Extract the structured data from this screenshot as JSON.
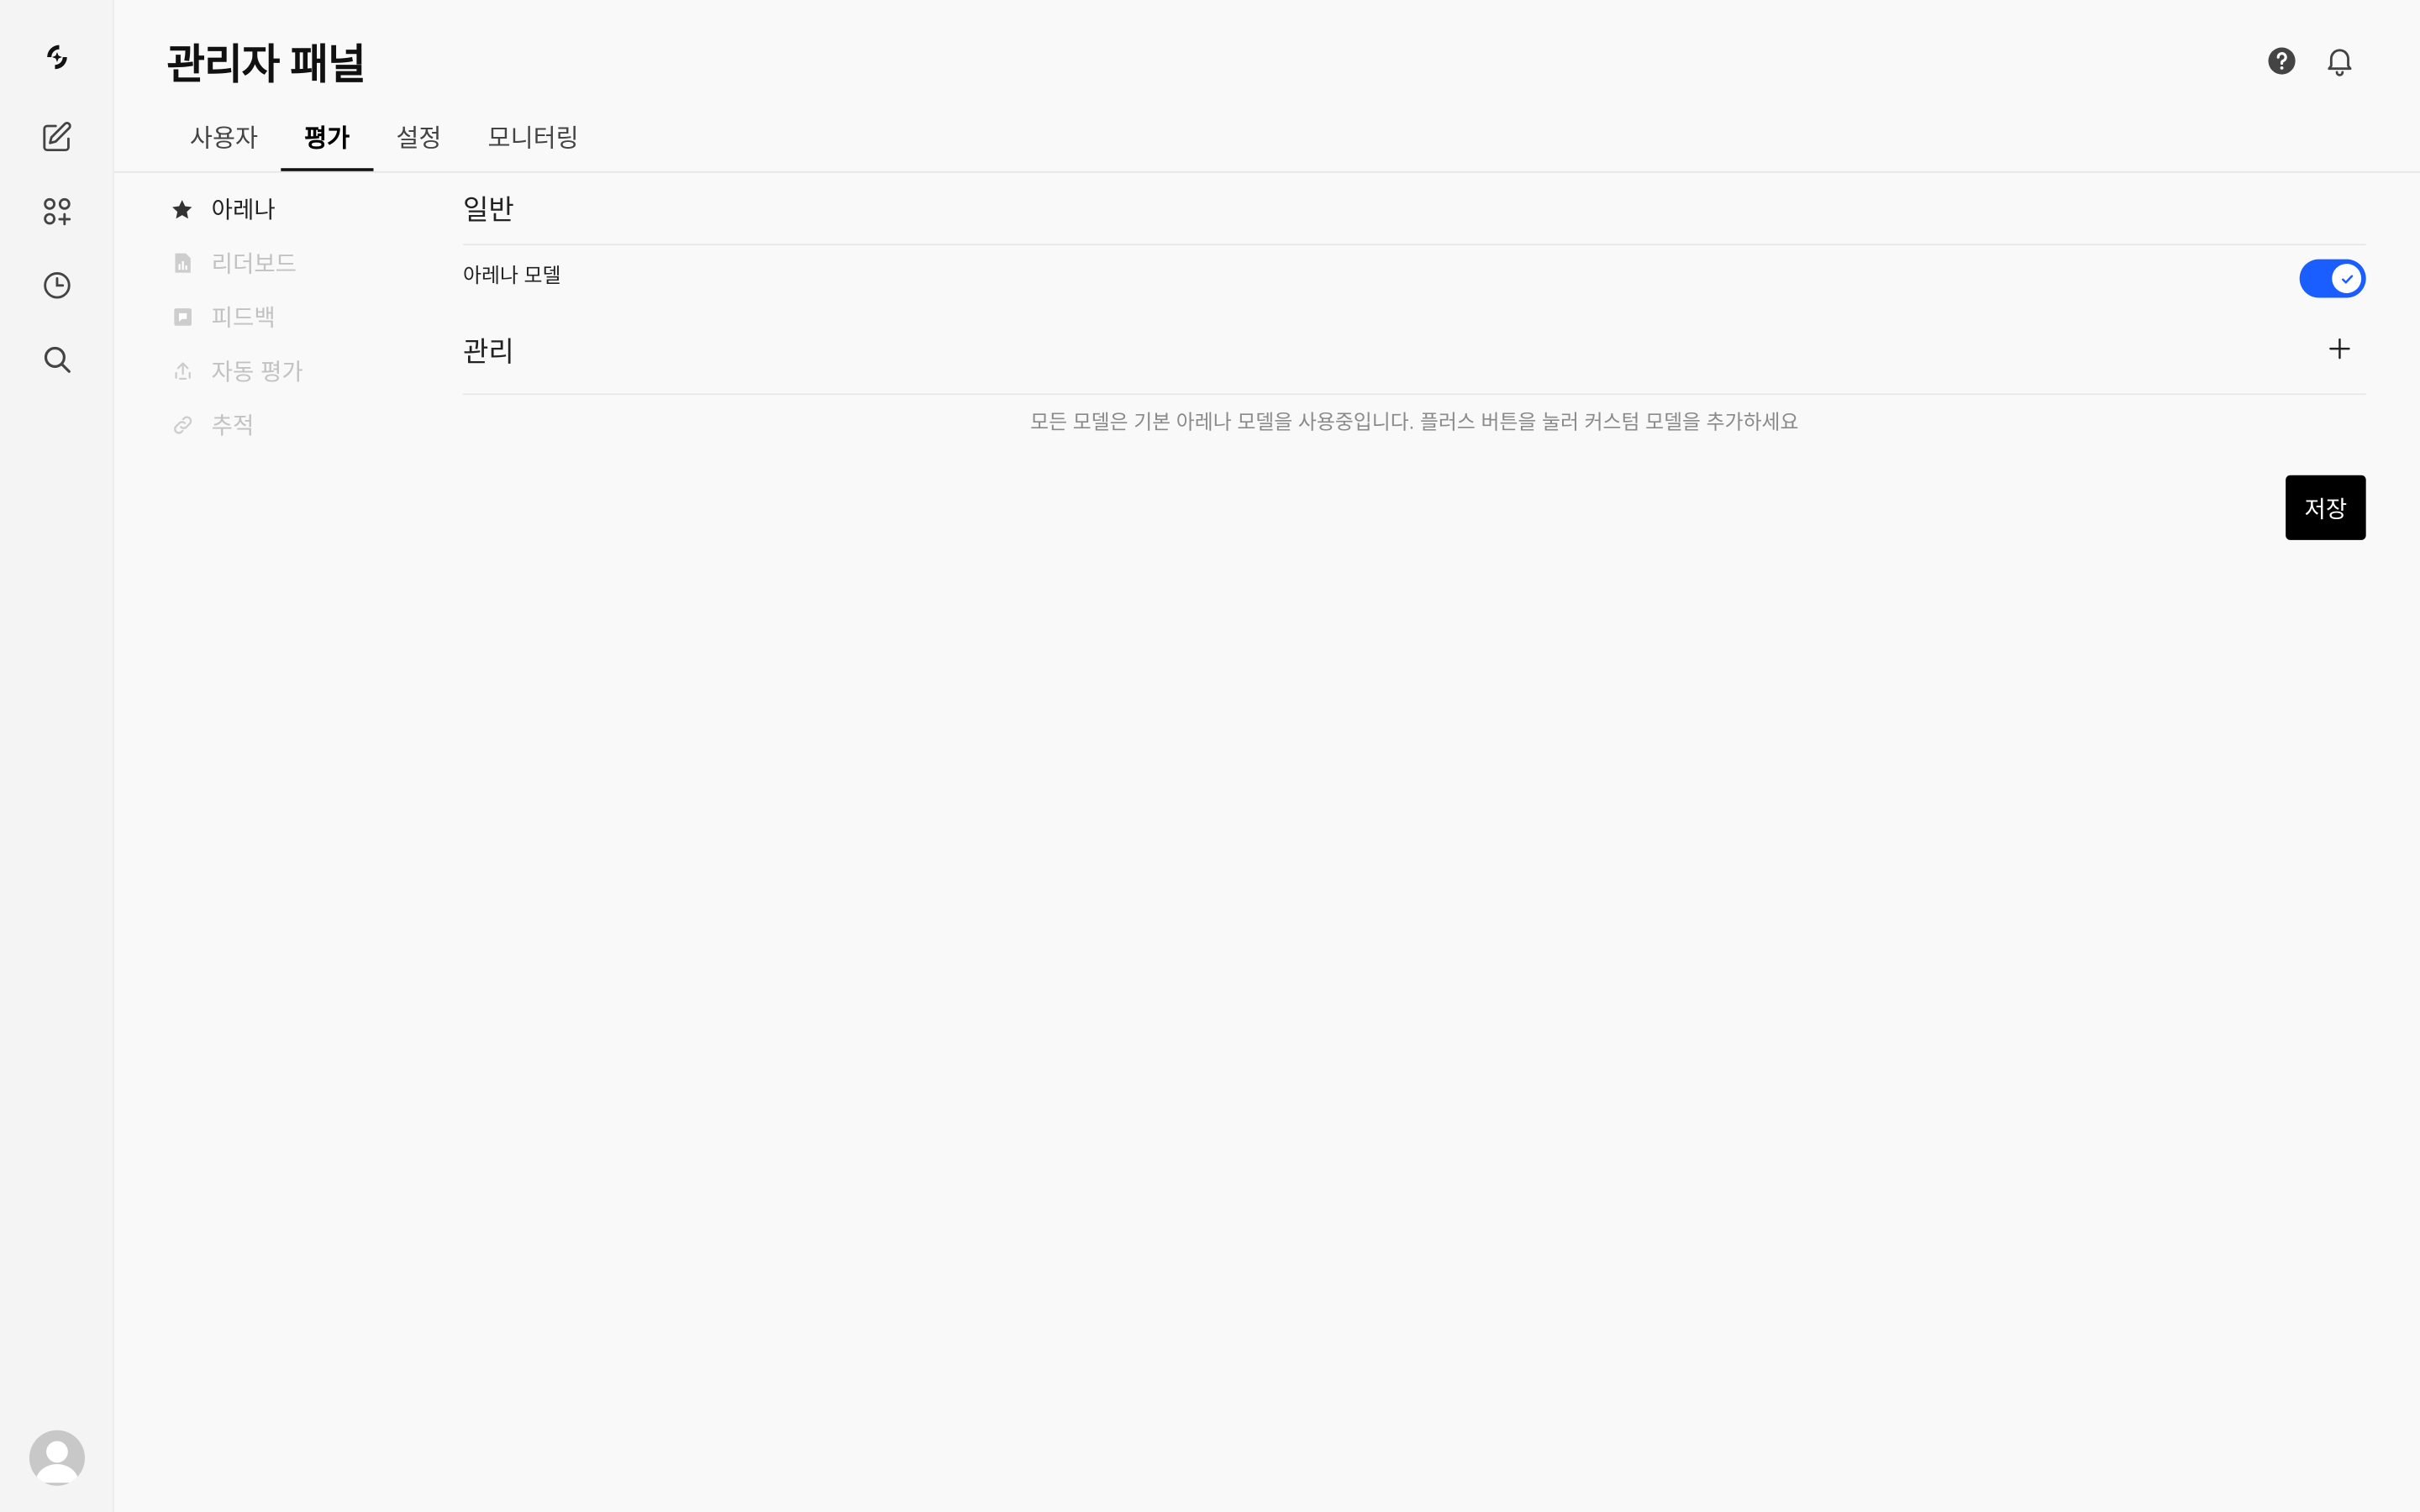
{
  "header": {
    "title": "관리자 패널"
  },
  "tabs": [
    {
      "label": "사용자",
      "active": false
    },
    {
      "label": "평가",
      "active": true
    },
    {
      "label": "설정",
      "active": false
    },
    {
      "label": "모니터링",
      "active": false
    }
  ],
  "subnav": [
    {
      "label": "아레나",
      "icon": "star-icon",
      "active": true
    },
    {
      "label": "리더보드",
      "icon": "chart-icon",
      "active": false
    },
    {
      "label": "피드백",
      "icon": "chat-icon",
      "active": false
    },
    {
      "label": "자동 평가",
      "icon": "upload-icon",
      "active": false
    },
    {
      "label": "추적",
      "icon": "link-icon",
      "active": false
    }
  ],
  "general": {
    "title": "일반",
    "arena_label": "아레나 모델",
    "arena_enabled": true
  },
  "manage": {
    "title": "관리",
    "empty_message": "모든 모델은 기본 아레나 모델을 사용중입니다. 플러스 버튼을 눌러 커스텀 모델을 추가하세요"
  },
  "save_label": "저장",
  "colors": {
    "accent": "#1a5eff",
    "save_button": "#000000"
  },
  "sidebar_icons": [
    "logo-icon",
    "new-chat-icon",
    "workspace-icon",
    "history-icon",
    "search-icon"
  ]
}
